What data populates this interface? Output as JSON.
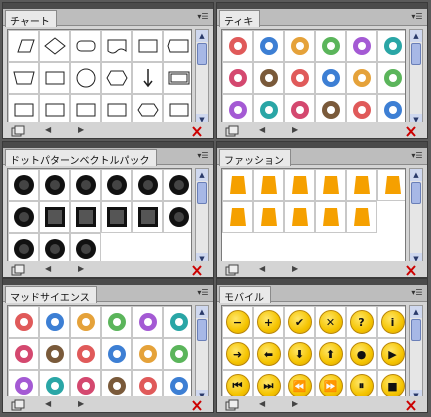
{
  "panels": [
    {
      "id": "chart",
      "title": "チャート",
      "kind": "flow",
      "menu": "▾☰",
      "items": [
        "parallelogram",
        "diamond",
        "rounded-rect",
        "document",
        "curved-rect",
        "pentagon-doc",
        "trapezoid",
        "rectangle",
        "circle",
        "hexagon",
        "arrow-down",
        "rect-double",
        "rect-small",
        "rect-wide",
        "rect-3",
        "rect-4",
        "octagon-flat",
        "rect-5"
      ]
    },
    {
      "id": "cars",
      "title": "ティキ",
      "kind": "color",
      "menu": "▾☰",
      "items": [
        "car",
        "bird",
        "woman-bikini",
        "man-black",
        "cocktail-set",
        "woman-blue",
        "tiki-lady",
        "fish",
        "guitar",
        "tiki-mask",
        "parasol",
        "woman-coat",
        "cocktail",
        "palm",
        "plant",
        "chair",
        "table-lamp",
        "alien"
      ]
    },
    {
      "id": "dots",
      "title": "ドットパターンベクトルパック",
      "kind": "dots",
      "menu": "▾☰",
      "items": [
        "splat",
        "splat",
        "splat",
        "splat",
        "splat",
        "splat",
        "blob",
        "square",
        "square",
        "square",
        "square",
        "circle",
        "grid-circle",
        "grid-circle",
        "circle"
      ]
    },
    {
      "id": "fashion",
      "title": "ファッション",
      "kind": "fashion",
      "menu": "▾☰",
      "items": [
        "pants",
        "dress",
        "heels",
        "flat-shoe",
        "boot",
        "tshirt",
        "jacket",
        "tank",
        "bag",
        "skirt",
        "cap"
      ]
    },
    {
      "id": "science",
      "title": "マッドサイエンス",
      "kind": "science",
      "menu": "▾☰",
      "items": [
        "atom",
        "atom-orange",
        "atom-purple",
        "device",
        "gear",
        "chip",
        "molecule",
        "flask",
        "magnifier",
        "microscope",
        "helix",
        "gear-blue",
        "helix-swirl",
        "pi",
        "brain",
        "radiation",
        "telescope",
        "beaker"
      ]
    },
    {
      "id": "mobile",
      "title": "モバイル",
      "kind": "mobile",
      "menu": "▾☰",
      "items": [
        "−",
        "+",
        "✔",
        "✕",
        "?",
        "i",
        "➜",
        "⬅",
        "⬇",
        "⬆",
        "●",
        "▶",
        "⏮",
        "⏭",
        "⏪",
        "⏩",
        "⏸",
        "■"
      ]
    }
  ],
  "bottom": {
    "prev": "◀",
    "next": "▶"
  },
  "colors": {
    "orange": "#f5a000",
    "yellow": "#f5c400"
  }
}
